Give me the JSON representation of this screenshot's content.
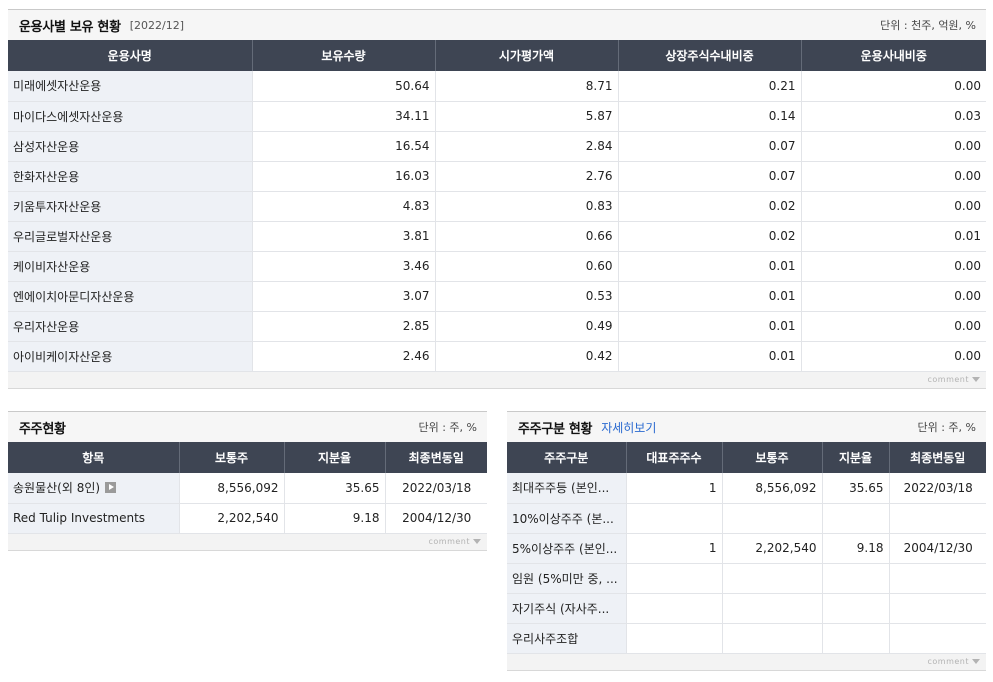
{
  "holdings": {
    "title": "운용사별 보유 현황",
    "period": "[2022/12]",
    "unit": "단위 : 천주, 억원, %",
    "columns": [
      "운용사명",
      "보유수량",
      "시가평가액",
      "상장주식수내비중",
      "운용사내비중"
    ],
    "rows": [
      [
        "미래에셋자산운용",
        "50.64",
        "8.71",
        "0.21",
        "0.00"
      ],
      [
        "마이다스에셋자산운용",
        "34.11",
        "5.87",
        "0.14",
        "0.03"
      ],
      [
        "삼성자산운용",
        "16.54",
        "2.84",
        "0.07",
        "0.00"
      ],
      [
        "한화자산운용",
        "16.03",
        "2.76",
        "0.07",
        "0.00"
      ],
      [
        "키움투자자산운용",
        "4.83",
        "0.83",
        "0.02",
        "0.00"
      ],
      [
        "우리글로벌자산운용",
        "3.81",
        "0.66",
        "0.02",
        "0.01"
      ],
      [
        "케이비자산운용",
        "3.46",
        "0.60",
        "0.01",
        "0.00"
      ],
      [
        "엔에이치아문디자산운용",
        "3.07",
        "0.53",
        "0.01",
        "0.00"
      ],
      [
        "우리자산운용",
        "2.85",
        "0.49",
        "0.01",
        "0.00"
      ],
      [
        "아이비케이자산운용",
        "2.46",
        "0.42",
        "0.01",
        "0.00"
      ]
    ],
    "comment_label": "comment"
  },
  "shareholders": {
    "title": "주주현황",
    "unit": "단위 : 주, %",
    "columns": [
      "항목",
      "보통주",
      "지분율",
      "최종변동일"
    ],
    "rows": [
      [
        "송원물산(외 8인)",
        "8,556,092",
        "35.65",
        "2022/03/18"
      ],
      [
        "Red Tulip Investments",
        "2,202,540",
        "9.18",
        "2004/12/30"
      ]
    ],
    "comment_label": "comment"
  },
  "shareholder_types": {
    "title": "주주구분 현황",
    "detail_link": "자세히보기",
    "unit": "단위 : 주, %",
    "columns": [
      "주주구분",
      "대표주주수",
      "보통주",
      "지분율",
      "최종변동일"
    ],
    "rows": [
      [
        "최대주주등 (본인...",
        "1",
        "8,556,092",
        "35.65",
        "2022/03/18"
      ],
      [
        "10%이상주주 (본...",
        "",
        "",
        "",
        ""
      ],
      [
        "5%이상주주 (본인...",
        "1",
        "2,202,540",
        "9.18",
        "2004/12/30"
      ],
      [
        "임원 (5%미만 중, ...",
        "",
        "",
        "",
        ""
      ],
      [
        "자기주식 (자사주...",
        "",
        "",
        "",
        ""
      ],
      [
        "우리사주조합",
        "",
        "",
        "",
        ""
      ]
    ],
    "comment_label": "comment"
  }
}
